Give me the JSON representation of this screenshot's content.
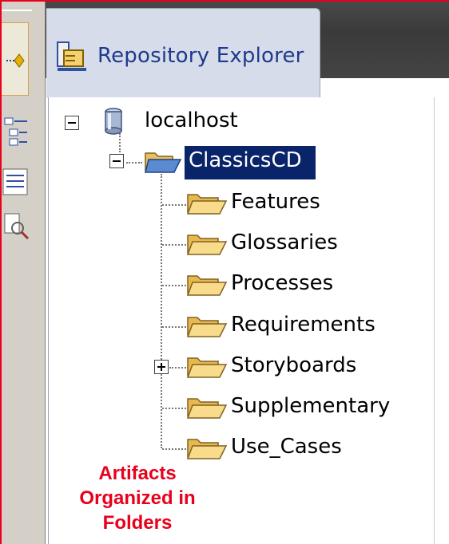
{
  "tab": {
    "title": "Repository Explorer",
    "icon": "repository-explorer-icon"
  },
  "tree": {
    "root": {
      "label": "localhost",
      "icon": "database-icon",
      "expanded": true
    },
    "project": {
      "label": "ClassicsCD",
      "icon": "open-folder-icon",
      "expanded": true,
      "selected": true
    },
    "folders": [
      {
        "label": "Features",
        "icon": "folder-icon",
        "expandable": false
      },
      {
        "label": "Glossaries",
        "icon": "folder-icon",
        "expandable": false
      },
      {
        "label": "Processes",
        "icon": "folder-icon",
        "expandable": false
      },
      {
        "label": "Requirements",
        "icon": "folder-icon",
        "expandable": false
      },
      {
        "label": "Storyboards",
        "icon": "folder-icon",
        "expandable": true
      },
      {
        "label": "Supplementary",
        "icon": "folder-icon",
        "expandable": false
      },
      {
        "label": "Use_Cases",
        "icon": "folder-icon",
        "expandable": false
      }
    ]
  },
  "annotation": {
    "lines": [
      "Artifacts",
      "Organized in",
      "Folders"
    ],
    "color": "#e8001c"
  },
  "colors": {
    "selection": "#0a246a",
    "tab_text": "#1e3a8c",
    "folder": "#f5c968"
  }
}
